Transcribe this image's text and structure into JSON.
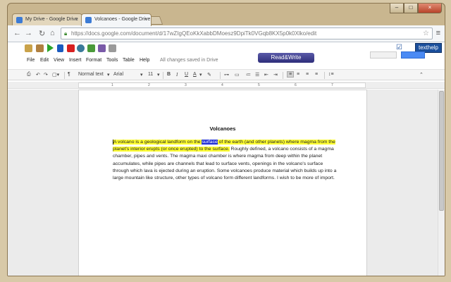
{
  "browser": {
    "tabs": [
      {
        "title": "My Drive - Google Drive",
        "active": false
      },
      {
        "title": "Volcanoes - Google Drive",
        "active": true
      }
    ],
    "url": "https://docs.google.com/document/d/17wZIgQEoKkXabbDMoesz9DpiTk0VGqb8KX5p0k0Xlko/edit",
    "window_controls": {
      "minimize": "–",
      "maximize": "□",
      "close": "×"
    }
  },
  "extensions": {
    "texthelp_label": "texthelp"
  },
  "menu": {
    "items": [
      "File",
      "Edit",
      "View",
      "Insert",
      "Format",
      "Tools",
      "Table",
      "Help"
    ],
    "saved_status": "All changes saved in Drive"
  },
  "readwrite": {
    "label": "Read&Write"
  },
  "toolbar": {
    "style": "Normal text",
    "font": "Arial",
    "size": "11"
  },
  "ruler": {
    "numbers": [
      "1",
      "2",
      "3",
      "4",
      "5",
      "6",
      "7"
    ]
  },
  "document": {
    "title": "Volcanoes",
    "highlighted_before": "A volcano is a geological landform on the ",
    "selected_word": "surface",
    "highlighted_after": " of the earth (and other planets) where magma from the planet's interior erupts (or once erupted) to the surface.",
    "body_rest": " Roughly defined, a volcano consists of a magma chamber, pipes and vents. The magma maxi chamber is where magma from deep within the planet  accumulates, while pipes are channels that lead to surface vents, openings in the volcano's surface through which lava is ejected during an eruption. Some volcanoes produce material which builds up into a large mountain like structure, other types of volcano form different landforms. I wish to be more of import."
  },
  "colors": {
    "highlight": "#ffff33",
    "selection": "#1f2fd6",
    "readwrite": "#2d2d7a"
  }
}
